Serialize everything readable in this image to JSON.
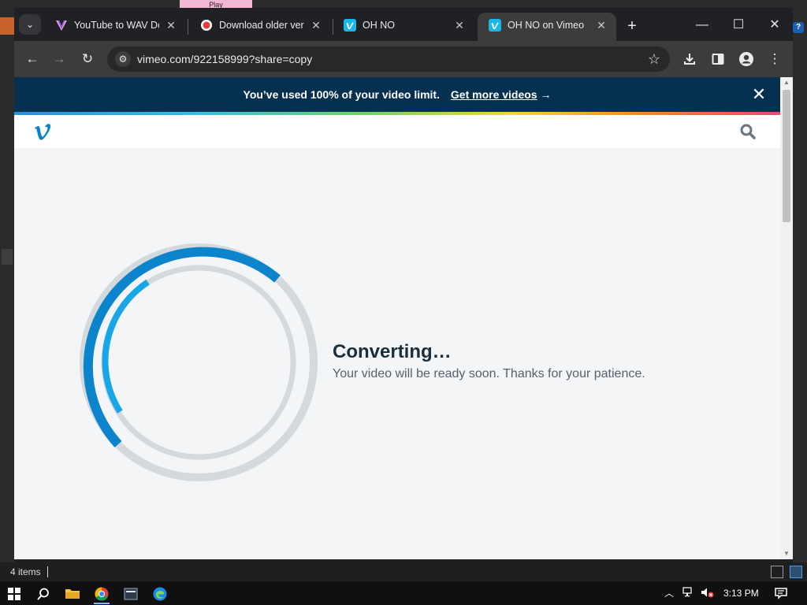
{
  "browser": {
    "tabs": [
      {
        "title": "YouTube to WAV Dov",
        "favicon": "vector-v-icon",
        "active": false
      },
      {
        "title": "Download older versi",
        "favicon": "record-icon",
        "active": false
      },
      {
        "title": "OH NO",
        "favicon": "vimeo-icon",
        "active": false
      },
      {
        "title": "OH NO on Vimeo",
        "favicon": "vimeo-icon",
        "active": true
      }
    ],
    "url": "vimeo.com/922158999?share=copy"
  },
  "banner": {
    "message": "You’ve used 100% of your video limit.",
    "link": "Get more videos",
    "arrow": "→"
  },
  "main": {
    "title": "Converting…",
    "subtitle": "Your video will be ready soon. Thanks for your patience."
  },
  "desktop": {
    "pink_label": "Play"
  },
  "statusbar": {
    "items": "4 items"
  },
  "taskbar": {
    "time": "3:13 PM"
  },
  "colors": {
    "brand": "#00adef",
    "banner_bg": "#05304f",
    "ring_outer": "#0b84cc",
    "ring_inner": "#17a7e8",
    "ring_track": "#d3d9dd"
  }
}
